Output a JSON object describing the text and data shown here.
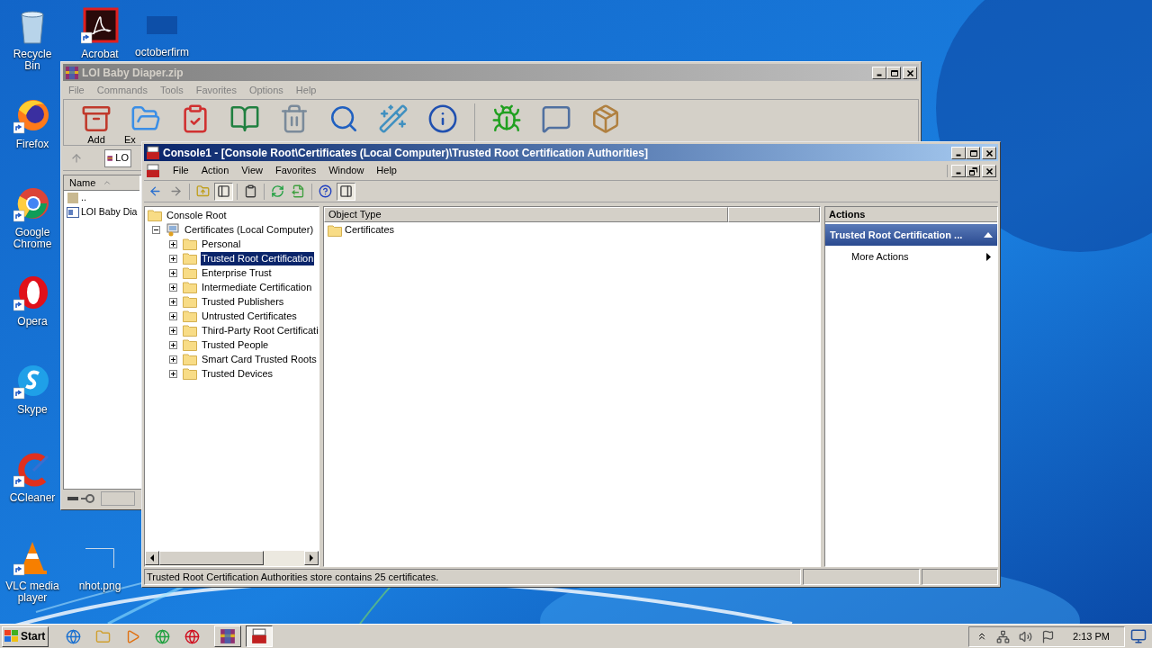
{
  "desktop_icons": [
    {
      "label": "Recycle Bin"
    },
    {
      "label": "Acrobat"
    },
    {
      "label": "octoberfirm"
    },
    {
      "label": "Firefox"
    },
    {
      "label": "Google Chrome"
    },
    {
      "label": "Opera"
    },
    {
      "label": "Skype"
    },
    {
      "label": "CCleaner"
    },
    {
      "label": "VLC media player"
    },
    {
      "label": "nhot.png"
    }
  ],
  "archive_window": {
    "title": "LOI Baby Diaper.zip",
    "menu": [
      "File",
      "Commands",
      "Tools",
      "Favorites",
      "Options",
      "Help"
    ],
    "toolbar_labels": [
      "Add",
      "Ex"
    ],
    "address": "LO",
    "columns": [
      "Name"
    ],
    "rows": [
      "..",
      "LOI Baby Dia"
    ]
  },
  "console_window": {
    "title": "Console1 - [Console Root\\Certificates (Local Computer)\\Trusted Root Certification Authorities]",
    "menu": [
      "File",
      "Action",
      "View",
      "Favorites",
      "Window",
      "Help"
    ],
    "tree": [
      {
        "label": "Console Root",
        "selected": false,
        "children": [
          {
            "label": "Certificates (Local Computer)",
            "selected": false,
            "expanded": true,
            "children": [
              {
                "label": "Personal",
                "selected": false,
                "expanded": false
              },
              {
                "label": "Trusted Root Certification",
                "selected": true,
                "expanded": false
              },
              {
                "label": "Enterprise Trust",
                "selected": false,
                "expanded": false
              },
              {
                "label": "Intermediate Certification",
                "selected": false,
                "expanded": false
              },
              {
                "label": "Trusted Publishers",
                "selected": false,
                "expanded": false
              },
              {
                "label": "Untrusted Certificates",
                "selected": false,
                "expanded": false
              },
              {
                "label": "Third-Party Root Certificati",
                "selected": false,
                "expanded": false
              },
              {
                "label": "Trusted People",
                "selected": false,
                "expanded": false
              },
              {
                "label": "Smart Card Trusted Roots",
                "selected": false,
                "expanded": false
              },
              {
                "label": "Trusted Devices",
                "selected": false,
                "expanded": false
              }
            ]
          }
        ]
      }
    ],
    "list": {
      "columns": [
        "Object Type"
      ],
      "rows": [
        "Certificates"
      ]
    },
    "actions": {
      "title": "Actions",
      "section": "Trusted Root Certification ...",
      "items": [
        "More Actions"
      ]
    },
    "status_bar": "Trusted Root Certification Authorities store contains 25 certificates."
  },
  "taskbar": {
    "start": "Start",
    "apps": [
      {
        "selected": false
      },
      {
        "selected": true
      }
    ],
    "clock": "2:13 PM"
  }
}
